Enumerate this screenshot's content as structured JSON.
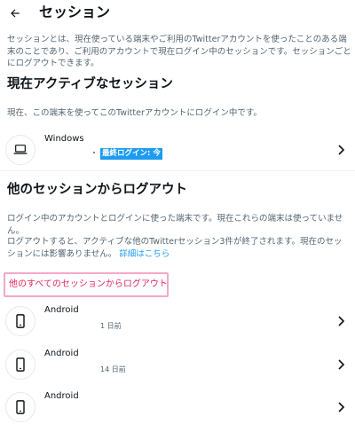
{
  "header": {
    "title": "セッション"
  },
  "intro": "セッションとは、現在使っている端末やご利用のTwitterアカウントを使ったことのある端末のことであり、ご利用のアカウントで現在ログイン中のセッションです。セッションごとにログアウトできます。",
  "active": {
    "title": "現在アクティブなセッション",
    "description": "現在、この端末を使ってこのTwitterアカウントにログイン中です。",
    "device": {
      "name": "Windows",
      "badge": "最終ログイン: 今"
    }
  },
  "others": {
    "title": "他のセッションからログアウト",
    "description1": "ログイン中のアカウントとログインに使った端末です。現在これらの端末は使っていません。",
    "description2": "ログアウトすると、アクティブな他のTwitterセッション3件が終了されます。現在のセッションには影響ありません。",
    "details_link": "詳細はこちら",
    "logout_all_label": "他のすべてのセッションからログアウト",
    "devices": [
      {
        "name": "Android",
        "meta": "1 日前"
      },
      {
        "name": "Android",
        "meta": "14 日前"
      },
      {
        "name": "Android",
        "meta": ""
      }
    ]
  },
  "icons": {
    "back": "arrow-left-icon",
    "desktop": "laptop-icon",
    "phone": "smartphone-icon",
    "chevron": "chevron-right-icon"
  },
  "colors": {
    "accent": "#1d9bf0",
    "danger": "#e0245e",
    "highlight_border": "#f4a7c8",
    "text_primary": "#0f1419",
    "text_secondary": "#536471"
  }
}
